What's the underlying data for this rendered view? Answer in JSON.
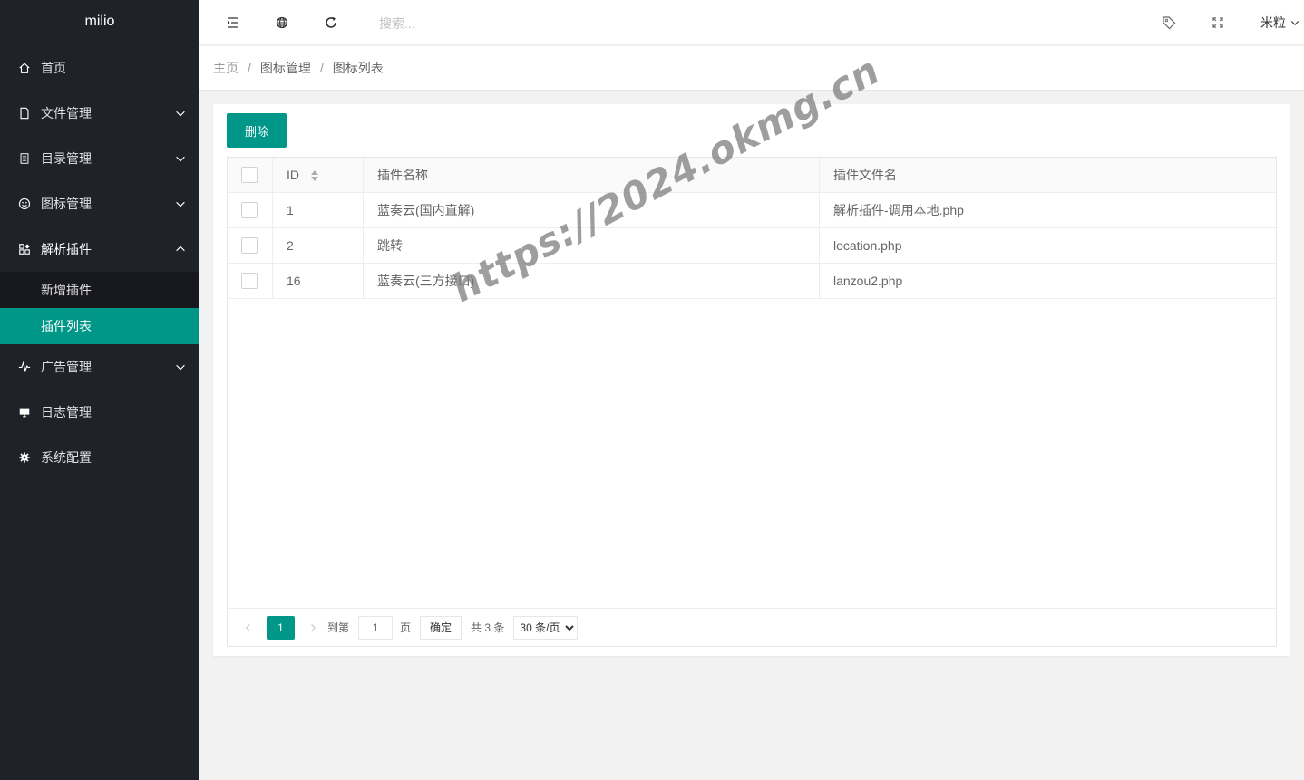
{
  "app": {
    "title": "milio"
  },
  "sidebar": {
    "items": [
      {
        "label": "首页",
        "icon": "home-icon"
      },
      {
        "label": "文件管理",
        "icon": "file-icon"
      },
      {
        "label": "目录管理",
        "icon": "list-icon"
      },
      {
        "label": "图标管理",
        "icon": "smile-icon"
      },
      {
        "label": "解析插件",
        "icon": "apps-icon"
      },
      {
        "label": "广告管理",
        "icon": "pulse-icon"
      },
      {
        "label": "日志管理",
        "icon": "monitor-icon"
      },
      {
        "label": "系统配置",
        "icon": "gear-icon"
      }
    ],
    "plugin_children": [
      {
        "label": "新增插件"
      },
      {
        "label": "插件列表"
      }
    ]
  },
  "header": {
    "search_placeholder": "搜索...",
    "user_name": "米粒"
  },
  "breadcrumb": [
    "主页",
    "图标管理",
    "图标列表"
  ],
  "toolbar": {
    "delete_label": "删除"
  },
  "table": {
    "columns": [
      "ID",
      "插件名称",
      "插件文件名"
    ],
    "rows": [
      {
        "id": "1",
        "name": "蓝奏云(国内直解)",
        "file": "解析插件-调用本地.php"
      },
      {
        "id": "2",
        "name": "跳转",
        "file": "location.php"
      },
      {
        "id": "16",
        "name": "蓝奏云(三方接口)",
        "file": "lanzou2.php"
      }
    ]
  },
  "pager": {
    "current": "1",
    "goto_label": "到第",
    "goto_value": "1",
    "page_unit": "页",
    "confirm_label": "确定",
    "total_text": "共 3 条",
    "page_size": "30 条/页"
  },
  "colors": {
    "accent": "#009688",
    "sidebar_bg": "#20222a"
  },
  "watermark": "https://2024.okmg.cn"
}
